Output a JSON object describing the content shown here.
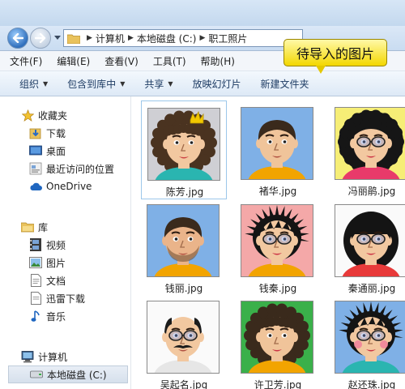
{
  "address": {
    "crumbs": [
      "计算机",
      "本地磁盘 (C:)",
      "职工照片"
    ]
  },
  "menu": [
    "文件(F)",
    "编辑(E)",
    "查看(V)",
    "工具(T)",
    "帮助(H)"
  ],
  "commands": [
    {
      "label": "组织",
      "dropdown": true
    },
    {
      "label": "包含到库中",
      "dropdown": true
    },
    {
      "label": "共享",
      "dropdown": true
    },
    {
      "label": "放映幻灯片",
      "dropdown": false
    },
    {
      "label": "新建文件夹",
      "dropdown": false
    }
  ],
  "callout": "待导入的图片",
  "sidebar": {
    "favorites": {
      "label": "收藏夹",
      "items": [
        "下载",
        "桌面",
        "最近访问的位置",
        "OneDrive"
      ]
    },
    "libraries": {
      "label": "库",
      "items": [
        "视频",
        "图片",
        "文档",
        "迅雷下载",
        "音乐"
      ]
    },
    "computer": {
      "label": "计算机",
      "items": [
        "本地磁盘 (C:)"
      ]
    }
  },
  "files": [
    {
      "name": "陈芳.jpg",
      "bg": "#cfcfd4",
      "hair": "#4a3320",
      "hairstyle": "curly",
      "skin": "#f2c8a0",
      "shirt": "#2ab5b0",
      "glasses": false,
      "accessory": "crown",
      "mouth": "#cc4444"
    },
    {
      "name": "褚华.jpg",
      "bg": "#7fb0e6",
      "hair": "#3a2a1c",
      "hairstyle": "short",
      "skin": "#f0c49a",
      "shirt": "#f2a400",
      "glasses": false,
      "accessory": "none",
      "mouth": "#b05040"
    },
    {
      "name": "冯丽鹃.jpg",
      "bg": "#f6ee76",
      "hair": "#161616",
      "hairstyle": "afro",
      "skin": "#f2c8a0",
      "shirt": "#e83a6a",
      "glasses": true,
      "accessory": "none",
      "mouth": "#cc3344"
    },
    {
      "name": "钱丽.jpg",
      "bg": "#7fb0e6",
      "hair": "#3a2a1c",
      "hairstyle": "short",
      "skin": "#eab48a",
      "shirt": "#f2a400",
      "glasses": false,
      "accessory": "beard",
      "mouth": "#b05040"
    },
    {
      "name": "钱秦.jpg",
      "bg": "#f4a8a8",
      "hair": "#141414",
      "hairstyle": "spiky",
      "skin": "#f2c8a0",
      "shirt": "#f2a400",
      "glasses": true,
      "accessory": "none",
      "mouth": "#cc3344"
    },
    {
      "name": "秦通丽.jpg",
      "bg": "#fafafa",
      "hair": "#141414",
      "hairstyle": "bowl",
      "skin": "#f2c8a0",
      "shirt": "#e83a3a",
      "glasses": true,
      "accessory": "none",
      "mouth": "#cc3344"
    },
    {
      "name": "吴起名.jpg",
      "bg": "#fafafa",
      "hair": "#1c1c1c",
      "hairstyle": "bald",
      "skin": "#f2c8a0",
      "shirt": "#e6e6e6",
      "glasses": true,
      "accessory": "mustache",
      "mouth": "#b05040"
    },
    {
      "name": "许卫芳.jpg",
      "bg": "#3ab04a",
      "hair": "#3a2a1c",
      "hairstyle": "curly",
      "skin": "#f0c49a",
      "shirt": "#f2a400",
      "glasses": false,
      "accessory": "none",
      "mouth": "#cc3344"
    },
    {
      "name": "赵还珠.jpg",
      "bg": "#7fb0e6",
      "hair": "#141414",
      "hairstyle": "spiky",
      "skin": "#f2c8a0",
      "shirt": "#2ab5b0",
      "glasses": true,
      "accessory": "blush",
      "mouth": "#cc3344"
    }
  ]
}
